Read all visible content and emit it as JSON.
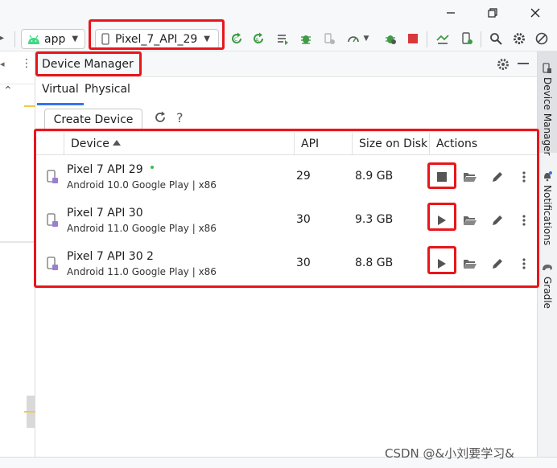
{
  "toolbar": {
    "run_config": "app",
    "device_selector": "Pixel_7_API_29"
  },
  "panel": {
    "title": "Device Manager",
    "tabs": [
      {
        "label": "Virtual",
        "active": true
      },
      {
        "label": "Physical",
        "active": false
      }
    ],
    "create_button": "Create Device",
    "help_label": "?"
  },
  "table": {
    "columns": [
      "Device",
      "API",
      "Size on Disk",
      "Actions"
    ],
    "sort_column": "Device",
    "rows": [
      {
        "name": "Pixel 7 API 29",
        "sub": "Android 10.0 Google Play | x86",
        "api": "29",
        "size": "8.9 GB",
        "running": true
      },
      {
        "name": "Pixel 7 API 30",
        "sub": "Android 11.0 Google Play | x86",
        "api": "30",
        "size": "9.3 GB",
        "running": false
      },
      {
        "name": "Pixel 7 API 30 2",
        "sub": "Android 11.0 Google Play | x86",
        "api": "30",
        "size": "8.8 GB",
        "running": false
      }
    ]
  },
  "right_strip": {
    "tabs": [
      "Device Manager",
      "Notifications",
      "Gradle"
    ]
  },
  "watermark": "CSDN @&小刘要学习&",
  "colors": {
    "annotation_red": "#e8161b",
    "accent_blue": "#3574f0",
    "run_green": "#3f9a44",
    "stop_red": "#d9383a",
    "online_green": "#3fb950"
  }
}
